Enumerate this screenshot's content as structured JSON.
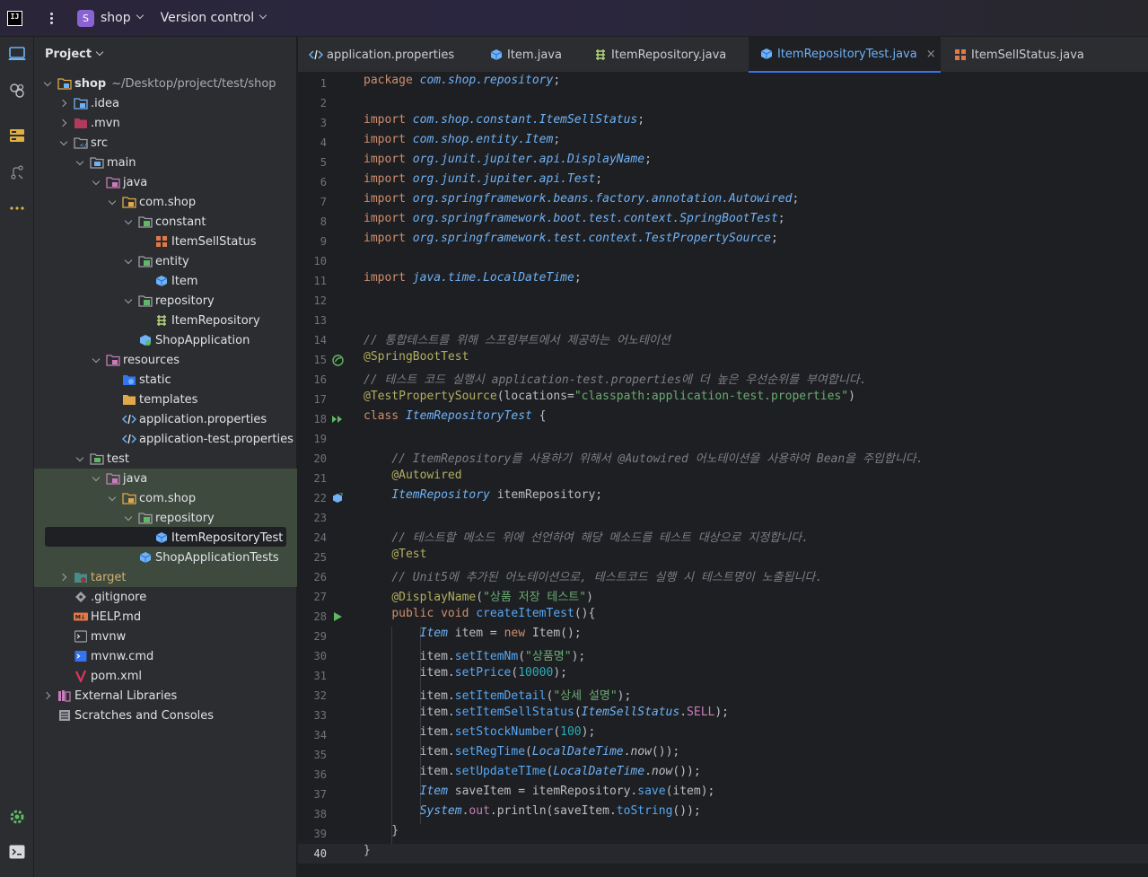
{
  "titlebar": {
    "logo": "IJ",
    "project_badge": "S",
    "project_name": "shop",
    "vcs_label": "Version control"
  },
  "toolstrip": {
    "icons": [
      "project-icon",
      "plugins-icon",
      "structure-icon",
      "vcs-icon",
      "more-icon",
      "settings-icon",
      "terminal-icon"
    ]
  },
  "project_panel": {
    "title": "Project",
    "tree": [
      {
        "label": "shop",
        "suffix": "~/Desktop/project/test/shop",
        "depth": 0,
        "arrow": "down",
        "icon": "module-folder"
      },
      {
        "label": ".idea",
        "depth": 1,
        "arrow": "right",
        "icon": "idea-folder"
      },
      {
        "label": ".mvn",
        "depth": 1,
        "arrow": "right",
        "icon": "mvn-folder"
      },
      {
        "label": "src",
        "depth": 1,
        "arrow": "down",
        "icon": "src-folder"
      },
      {
        "label": "main",
        "depth": 2,
        "arrow": "down",
        "icon": "folder"
      },
      {
        "label": "java",
        "depth": 3,
        "arrow": "down",
        "icon": "java-folder"
      },
      {
        "label": "com.shop",
        "depth": 4,
        "arrow": "down",
        "icon": "package-folder"
      },
      {
        "label": "constant",
        "depth": 5,
        "arrow": "down",
        "icon": "package"
      },
      {
        "label": "ItemSellStatus",
        "depth": 6,
        "arrow": "",
        "icon": "enum"
      },
      {
        "label": "entity",
        "depth": 5,
        "arrow": "down",
        "icon": "package"
      },
      {
        "label": "Item",
        "depth": 6,
        "arrow": "",
        "icon": "class"
      },
      {
        "label": "repository",
        "depth": 5,
        "arrow": "down",
        "icon": "package"
      },
      {
        "label": "ItemRepository",
        "depth": 6,
        "arrow": "",
        "icon": "interface"
      },
      {
        "label": "ShopApplication",
        "depth": 5,
        "arrow": "",
        "icon": "spring-class",
        "nest": true
      },
      {
        "label": "resources",
        "depth": 3,
        "arrow": "down",
        "icon": "resources-folder"
      },
      {
        "label": "static",
        "depth": 4,
        "arrow": "",
        "icon": "web-folder",
        "nest": true
      },
      {
        "label": "templates",
        "depth": 4,
        "arrow": "",
        "icon": "folder-yellow",
        "nest": true
      },
      {
        "label": "application.properties",
        "depth": 4,
        "arrow": "",
        "icon": "properties",
        "nest": true
      },
      {
        "label": "application-test.properties",
        "depth": 4,
        "arrow": "",
        "icon": "properties",
        "nest": true
      },
      {
        "label": "test",
        "depth": 2,
        "arrow": "down",
        "icon": "test-folder"
      },
      {
        "label": "java",
        "depth": 3,
        "arrow": "down",
        "icon": "java-folder"
      },
      {
        "label": "com.shop",
        "depth": 4,
        "arrow": "down",
        "icon": "package-folder"
      },
      {
        "label": "repository",
        "depth": 5,
        "arrow": "down",
        "icon": "package"
      },
      {
        "label": "ItemRepositoryTest",
        "depth": 6,
        "arrow": "",
        "icon": "class",
        "selected": true
      },
      {
        "label": "ShopApplicationTests",
        "depth": 5,
        "arrow": "",
        "icon": "class",
        "nest": true
      },
      {
        "label": "target",
        "depth": 1,
        "arrow": "right",
        "icon": "excluded-folder"
      },
      {
        "label": ".gitignore",
        "depth": 1,
        "arrow": "",
        "icon": "gitignore",
        "nest": true
      },
      {
        "label": "HELP.md",
        "depth": 1,
        "arrow": "",
        "icon": "markdown",
        "nest": true
      },
      {
        "label": "mvnw",
        "depth": 1,
        "arrow": "",
        "icon": "shell",
        "nest": true
      },
      {
        "label": "mvnw.cmd",
        "depth": 1,
        "arrow": "",
        "icon": "cmd",
        "nest": true
      },
      {
        "label": "pom.xml",
        "depth": 1,
        "arrow": "",
        "icon": "maven",
        "nest": true
      },
      {
        "label": "External Libraries",
        "depth": 0,
        "arrow": "right",
        "icon": "libraries"
      },
      {
        "label": "Scratches and Consoles",
        "depth": 0,
        "arrow": "",
        "icon": "scratches",
        "nest": true
      }
    ]
  },
  "tabs": [
    {
      "label": "application.properties",
      "icon": "properties",
      "active": false
    },
    {
      "label": "Item.java",
      "icon": "class",
      "active": false
    },
    {
      "label": "ItemRepository.java",
      "icon": "interface",
      "active": false
    },
    {
      "label": "ItemRepositoryTest.java",
      "icon": "class",
      "active": true,
      "close": "×"
    },
    {
      "label": "ItemSellStatus.java",
      "icon": "enum",
      "active": false
    }
  ],
  "editor": {
    "current_line": 40,
    "lines": [
      [
        [
          "kw",
          "package "
        ],
        [
          "pkgc",
          "com.shop.repository"
        ],
        [
          "",
          "; "
        ]
      ],
      [],
      [
        [
          "kw",
          "import "
        ],
        [
          "pkgc",
          "com.shop.constant.ItemSellStatus"
        ],
        [
          "",
          ";"
        ]
      ],
      [
        [
          "kw",
          "import "
        ],
        [
          "pkgc",
          "com.shop.entity.Item"
        ],
        [
          "",
          ";"
        ]
      ],
      [
        [
          "kw",
          "import "
        ],
        [
          "pkgc",
          "org.junit.jupiter.api.DisplayName"
        ],
        [
          "",
          ";"
        ]
      ],
      [
        [
          "kw",
          "import "
        ],
        [
          "pkgc",
          "org.junit.jupiter.api.Test"
        ],
        [
          "",
          ";"
        ]
      ],
      [
        [
          "kw",
          "import "
        ],
        [
          "pkgc",
          "org.springframework.beans.factory.annotation.Autowired"
        ],
        [
          "",
          ";"
        ]
      ],
      [
        [
          "kw",
          "import "
        ],
        [
          "pkgc",
          "org.springframework.boot.test.context.SpringBootTest"
        ],
        [
          "",
          ";"
        ]
      ],
      [
        [
          "kw",
          "import "
        ],
        [
          "pkgc",
          "org.springframework.test.context.TestPropertySource"
        ],
        [
          "",
          ";"
        ]
      ],
      [],
      [
        [
          "kw",
          "import "
        ],
        [
          "pkgc",
          "java.time.LocalDateTime"
        ],
        [
          "",
          ";"
        ]
      ],
      [],
      [],
      [
        [
          "cm",
          "// 통합테스트를 위해 스프링부트에서 제공하는 어노테이션"
        ]
      ],
      [
        [
          "ann",
          "@SpringBootTest"
        ]
      ],
      [
        [
          "cm",
          "// 테스트 코드 실행시 application-test.properties에 더 높은 우선순위를 부여합니다."
        ]
      ],
      [
        [
          "ann",
          "@TestPropertySource"
        ],
        [
          "",
          "("
        ],
        [
          "",
          "locations="
        ],
        [
          "str",
          "\"classpath:application-test.properties\""
        ],
        [
          "",
          ")"
        ]
      ],
      [
        [
          "kw",
          "class "
        ],
        [
          "ty",
          "ItemRepositoryTest"
        ],
        [
          "",
          " {"
        ]
      ],
      [],
      [
        [
          "",
          "    "
        ],
        [
          "cm",
          "// ItemRepository를 사용하기 위해서 @Autowired 어노테이션을 사용하여 Bean을 주입합니다."
        ]
      ],
      [
        [
          "",
          "    "
        ],
        [
          "ann",
          "@Autowired"
        ]
      ],
      [
        [
          "",
          "    "
        ],
        [
          "ty",
          "ItemRepository"
        ],
        [
          "",
          " itemRepository;"
        ]
      ],
      [],
      [
        [
          "",
          "    "
        ],
        [
          "cm",
          "// 테스트할 메소드 위에 선언하여 해당 메소드를 테스트 대상으로 지정합니다."
        ]
      ],
      [
        [
          "",
          "    "
        ],
        [
          "ann",
          "@Test"
        ]
      ],
      [
        [
          "",
          "    "
        ],
        [
          "cm",
          "// Unit5에 추가된 어노테이션으로, 테스트코드 실행 시 테스트명이 노출됩니다."
        ]
      ],
      [
        [
          "",
          "    "
        ],
        [
          "ann",
          "@DisplayName"
        ],
        [
          "",
          "("
        ],
        [
          "str",
          "\"상품 저장 테스트\""
        ],
        [
          "",
          ")"
        ]
      ],
      [
        [
          "",
          "    "
        ],
        [
          "kw",
          "public void "
        ],
        [
          "fn",
          "createItemTest"
        ],
        [
          "",
          "(){"
        ]
      ],
      [
        [
          "",
          "        "
        ],
        [
          "ty",
          "Item"
        ],
        [
          "",
          " item = "
        ],
        [
          "kw",
          "new "
        ],
        [
          "",
          "Item();"
        ]
      ],
      [
        [
          "",
          "        item."
        ],
        [
          "fn",
          "setItemNm"
        ],
        [
          "",
          "("
        ],
        [
          "str",
          "\"상품명\""
        ],
        [
          "",
          ");"
        ]
      ],
      [
        [
          "",
          "        item."
        ],
        [
          "fn",
          "setPrice"
        ],
        [
          "",
          "("
        ],
        [
          "num",
          "10000"
        ],
        [
          "",
          ");"
        ]
      ],
      [
        [
          "",
          "        item."
        ],
        [
          "fn",
          "setItemDetail"
        ],
        [
          "",
          "("
        ],
        [
          "str",
          "\"상세 설명\""
        ],
        [
          "",
          ");"
        ]
      ],
      [
        [
          "",
          "        item."
        ],
        [
          "fn",
          "setItemSellStatus"
        ],
        [
          "",
          "("
        ],
        [
          "ty",
          "ItemSellStatus"
        ],
        [
          "",
          "."
        ],
        [
          "fld",
          "SELL"
        ],
        [
          "",
          ");"
        ]
      ],
      [
        [
          "",
          "        item."
        ],
        [
          "fn",
          "setStockNumber"
        ],
        [
          "",
          "("
        ],
        [
          "num",
          "100"
        ],
        [
          "",
          ");"
        ]
      ],
      [
        [
          "",
          "        item."
        ],
        [
          "fn",
          "setRegTime"
        ],
        [
          "",
          "("
        ],
        [
          "ty",
          "LocalDateTime"
        ],
        [
          "",
          "."
        ],
        [
          "ital",
          "now"
        ],
        [
          "",
          "());"
        ]
      ],
      [
        [
          "",
          "        item."
        ],
        [
          "fn",
          "setUpdateTIme"
        ],
        [
          "",
          "("
        ],
        [
          "ty",
          "LocalDateTime"
        ],
        [
          "",
          "."
        ],
        [
          "ital",
          "now"
        ],
        [
          "",
          "());"
        ]
      ],
      [
        [
          "",
          "        "
        ],
        [
          "ty",
          "Item"
        ],
        [
          "",
          " saveItem = itemRepository."
        ],
        [
          "fn",
          "save"
        ],
        [
          "",
          "(item);"
        ]
      ],
      [
        [
          "",
          "        "
        ],
        [
          "ty",
          "System"
        ],
        [
          "",
          "."
        ],
        [
          "fld",
          "out"
        ],
        [
          "",
          ".println(saveItem."
        ],
        [
          "fn",
          "toString"
        ],
        [
          "",
          "());"
        ]
      ],
      [
        [
          "",
          "    }"
        ]
      ],
      [
        [
          "",
          "}"
        ]
      ]
    ]
  }
}
